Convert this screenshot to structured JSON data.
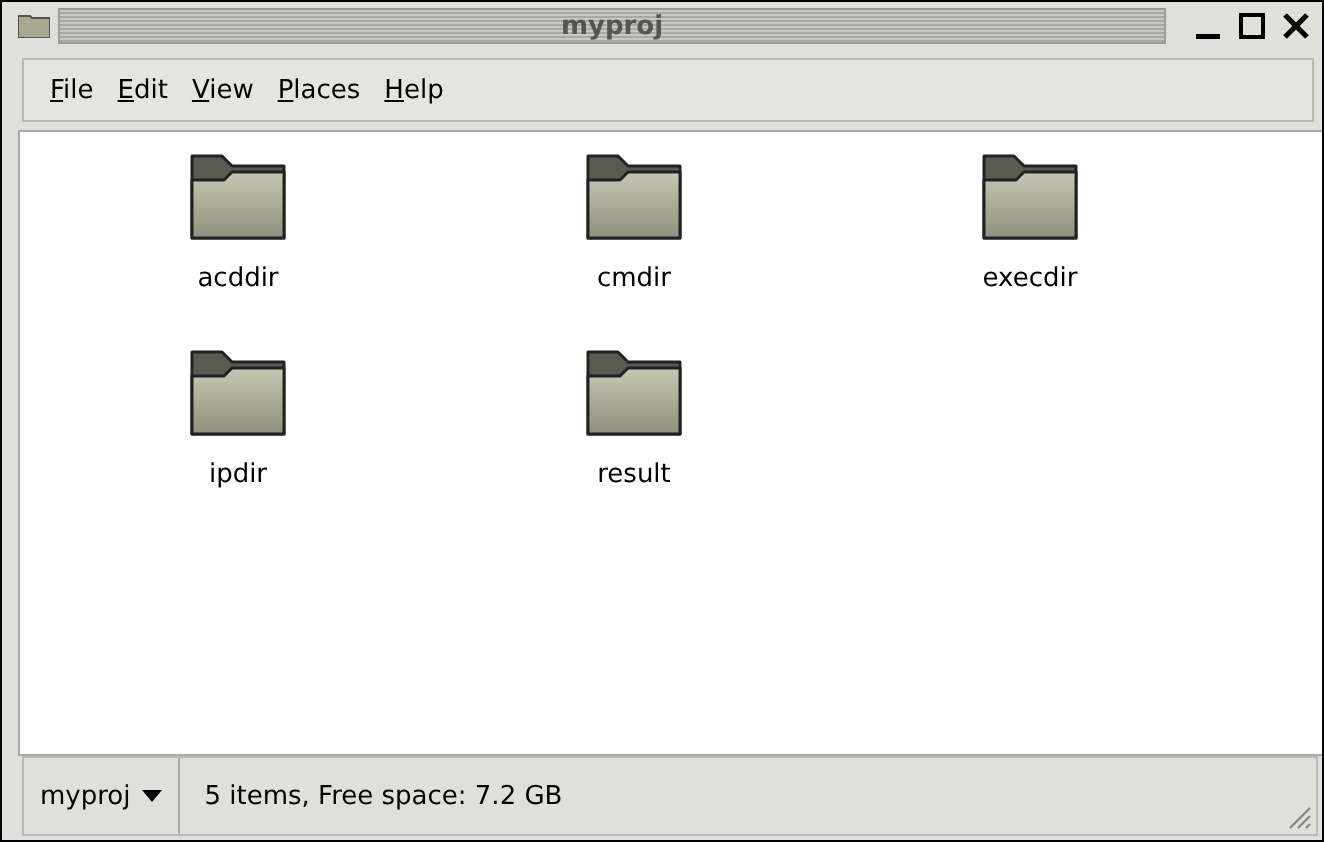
{
  "window": {
    "title": "myproj"
  },
  "menu": [
    {
      "label": "File",
      "underline_first": true
    },
    {
      "label": "Edit",
      "underline_first": true
    },
    {
      "label": "View",
      "underline_first": true
    },
    {
      "label": "Places",
      "underline_first": true
    },
    {
      "label": "Help",
      "underline_first": true
    }
  ],
  "items": [
    {
      "name": "acddir",
      "selected": false
    },
    {
      "name": "cmdir",
      "selected": false
    },
    {
      "name": "execdir",
      "selected": false
    },
    {
      "name": "ipdir",
      "selected": false
    },
    {
      "name": "result",
      "selected": false
    }
  ],
  "status_bar": {
    "location": "myproj",
    "info": "5 items, Free space: 7.2 GB"
  }
}
